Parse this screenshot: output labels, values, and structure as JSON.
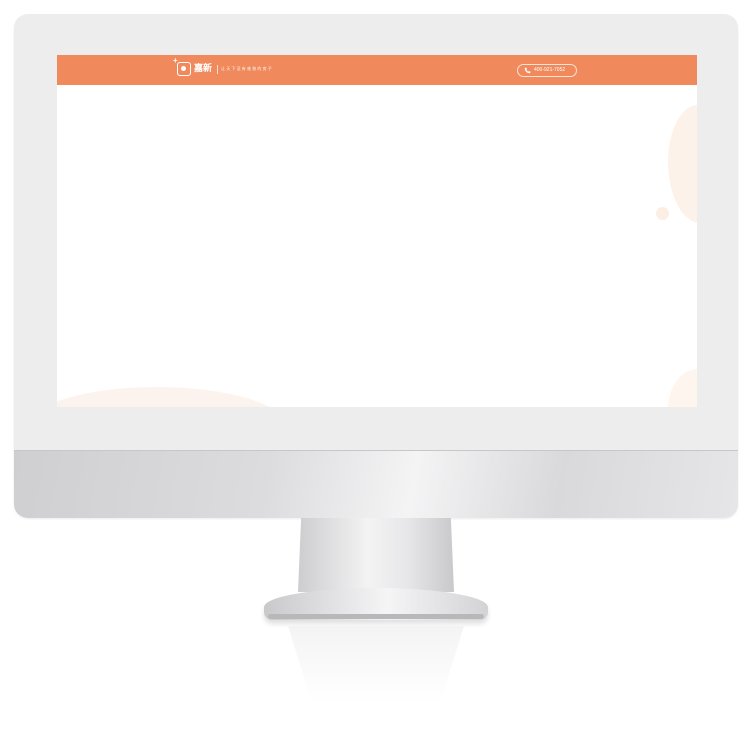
{
  "header": {
    "logo_name": "嘉新",
    "slogan": "让天下没有难装的房子",
    "phone": "400-921-7052"
  },
  "colors": {
    "header_bg": "#f08a5d",
    "accent_blob": "#fdf2e9",
    "bezel": "#ededee"
  },
  "icons": {
    "logo": "logo-icon",
    "phone": "phone-icon"
  }
}
